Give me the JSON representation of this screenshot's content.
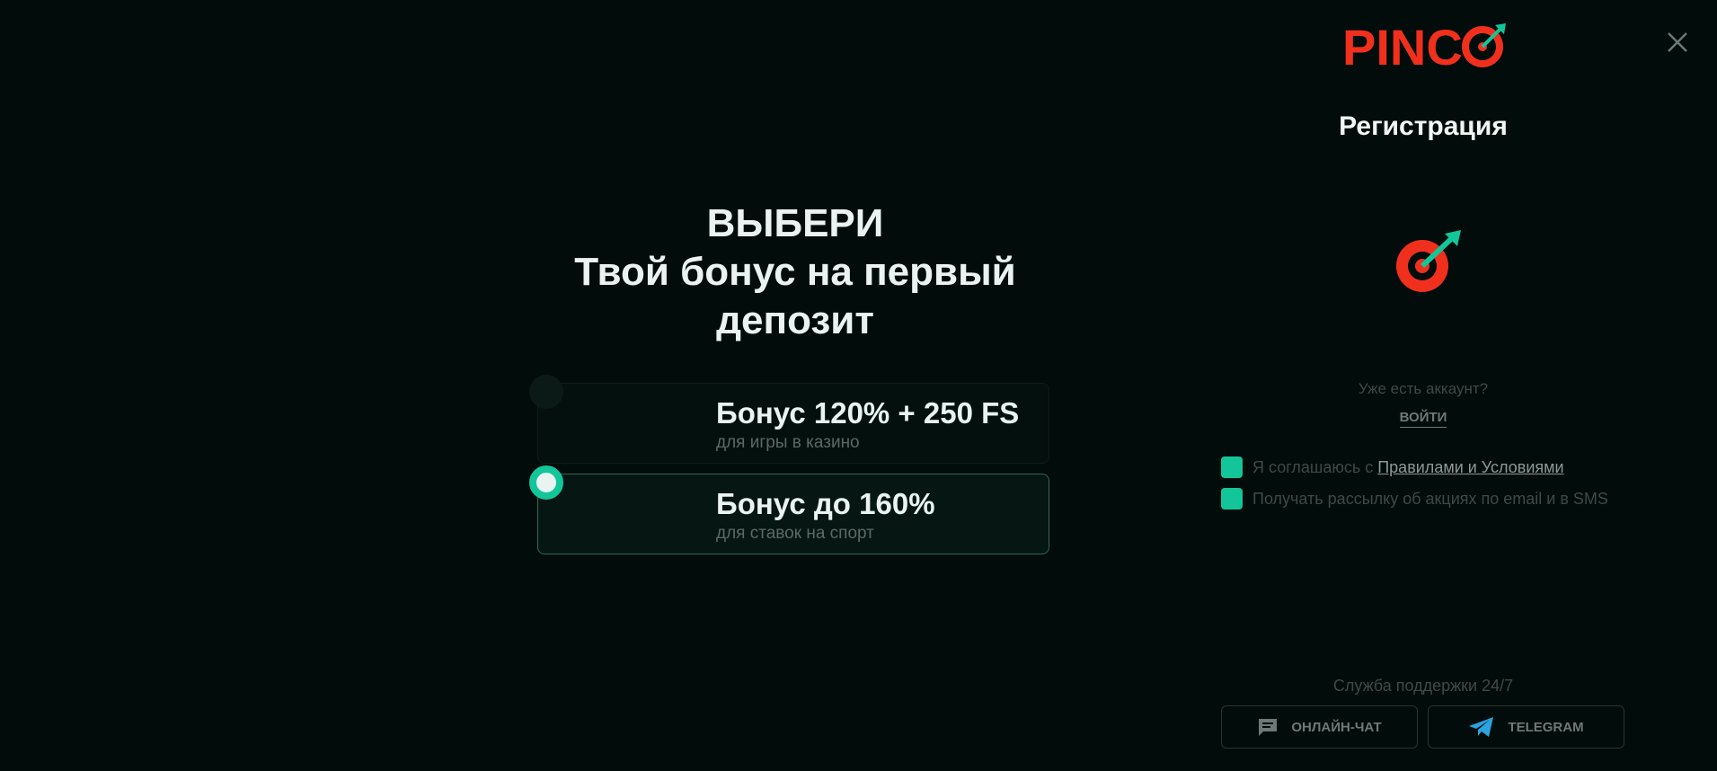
{
  "promo": {
    "title_line1": "ВЫБЕРИ",
    "title_line2": "Твой бонус на первый",
    "title_line3": "депозит",
    "bonuses": [
      {
        "title": "Бонус 120% + 250 FS",
        "subtitle": "для игры в казино",
        "selected": false
      },
      {
        "title": "Бонус до 160%",
        "subtitle": "для ставок на спорт",
        "selected": true
      }
    ]
  },
  "header": {
    "logo_text": "PINCO",
    "close_icon": "close-icon"
  },
  "registration": {
    "title": "Регистрация",
    "have_account": "Уже есть аккаунт?",
    "login_label": "ВОЙТИ",
    "agree_prefix": "Я соглашаюсь с ",
    "agree_link": "Правилами и Условиями",
    "newsletter_label": "Получать рассылку об акциях по email и в SMS",
    "agree_checked": true,
    "newsletter_checked": true
  },
  "support": {
    "label": "Служба поддержки 24/7",
    "chat_label": "ОНЛАЙН-ЧАТ",
    "telegram_label": "TELEGRAM"
  },
  "colors": {
    "background": "#020c0a",
    "accent": "#12c69a",
    "brand_red": "#f0301c"
  }
}
